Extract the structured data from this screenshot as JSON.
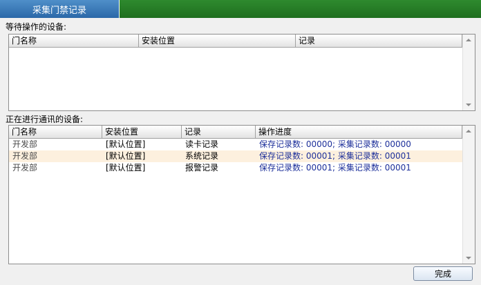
{
  "window": {
    "tab_title": "采集门禁记录"
  },
  "waiting": {
    "label": "等待操作的设备:",
    "columns": [
      "门名称",
      "安装位置",
      "记录"
    ],
    "rows": []
  },
  "active": {
    "label": "正在进行通讯的设备:",
    "columns": [
      "门名称",
      "安装位置",
      "记录",
      "操作进度"
    ],
    "rows": [
      {
        "door": "开发部",
        "location": "[默认位置]",
        "record": "读卡记录",
        "progress": "保存记录数: 00000; 采集记录数: 00000"
      },
      {
        "door": "开发部",
        "location": "[默认位置]",
        "record": "系统记录",
        "progress": "保存记录数: 00001; 采集记录数: 00001"
      },
      {
        "door": "开发部",
        "location": "[默认位置]",
        "record": "报警记录",
        "progress": "保存记录数: 00001; 采集记录数: 00001"
      }
    ]
  },
  "buttons": {
    "finish": "完成"
  },
  "colors": {
    "tab_bg": "#2b68a8",
    "bar_bg": "#1f6e1f",
    "row_highlight": "#fdf0de",
    "progress_text": "#1c2f9a"
  }
}
